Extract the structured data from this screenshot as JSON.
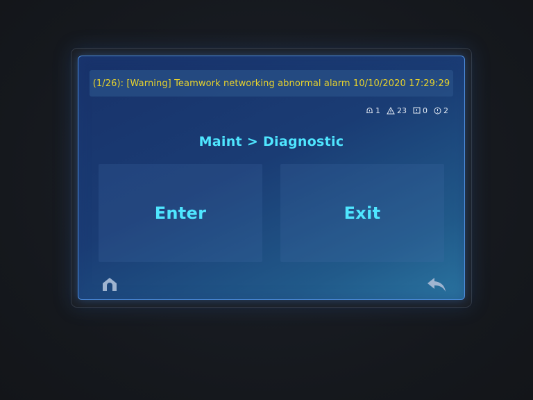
{
  "alarm_banner": {
    "text": "(1/26): [Warning] Teamwork networking abnormal alarm 10/10/2020 17:29:29"
  },
  "status_counts": {
    "bell_count": "1",
    "warning_count": "23",
    "alert_count": "0",
    "info_count": "2"
  },
  "page": {
    "title": "Maint > Diagnostic"
  },
  "actions": {
    "enter_label": "Enter",
    "exit_label": "Exit"
  },
  "colors": {
    "accent": "#4fe6ff",
    "alarm_text": "#e8d32c",
    "screen_border": "#4f8fe0"
  },
  "icons": {
    "status": [
      "bell-icon",
      "warning-triangle-icon",
      "alert-square-icon",
      "info-circle-icon"
    ],
    "nav": [
      "home-icon",
      "back-arrow-icon"
    ]
  }
}
